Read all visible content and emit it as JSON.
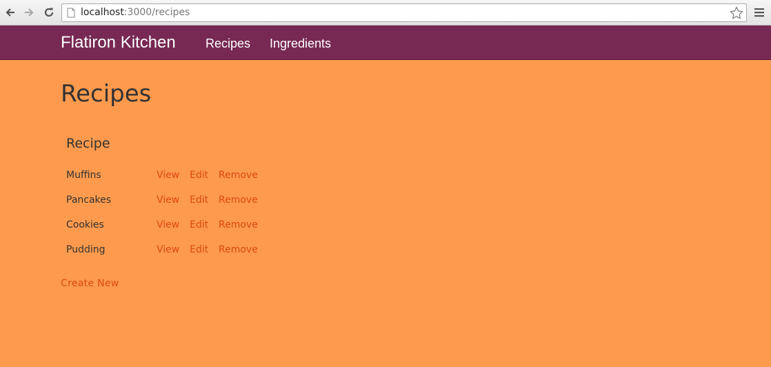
{
  "browser": {
    "url_host": "localhost",
    "url_path": ":3000/recipes",
    "icons": [
      "back-arrow-icon",
      "forward-arrow-icon",
      "reload-icon",
      "page-icon",
      "star-icon",
      "menu-icon"
    ]
  },
  "navbar": {
    "brand": "Flatiron Kitchen",
    "links": [
      "Recipes",
      "Ingredients"
    ],
    "background": "#772953"
  },
  "main": {
    "title": "Recipes",
    "table_header": "Recipe",
    "rows": [
      {
        "name": "Muffins",
        "view": "View",
        "edit": "Edit",
        "remove": "Remove"
      },
      {
        "name": "Pancakes",
        "view": "View",
        "edit": "Edit",
        "remove": "Remove"
      },
      {
        "name": "Cookies",
        "view": "View",
        "edit": "Edit",
        "remove": "Remove"
      },
      {
        "name": "Pudding",
        "view": "View",
        "edit": "Edit",
        "remove": "Remove"
      }
    ],
    "create_new": "Create New",
    "background": "#fd9a4d",
    "link_color": "#dd4814"
  }
}
